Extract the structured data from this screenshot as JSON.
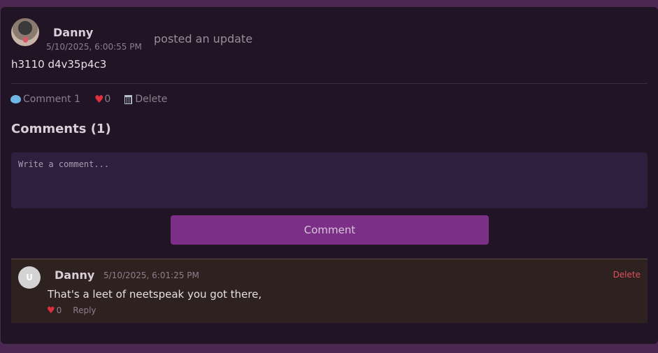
{
  "post": {
    "author": "Danny",
    "timestamp": "5/10/2025, 6:00:55 PM",
    "action_text": "posted an update",
    "body": "h3110 d4v35p4c3",
    "actions": {
      "comment_label": "Comment 1",
      "like_count": "0",
      "delete_label": "Delete"
    }
  },
  "comments_section": {
    "title": "Comments (1)",
    "input_placeholder": "Write a comment...",
    "submit_label": "Comment",
    "items": [
      {
        "avatar_initial": "U",
        "author": "Danny",
        "timestamp": "5/10/2025, 6:01:25 PM",
        "delete_label": "Delete",
        "text": "That's a leet of neetspeak you got there,",
        "like_count": "0",
        "reply_label": "Reply"
      }
    ]
  },
  "icons": {
    "comment": "speech-bubble-icon",
    "like": "heart-icon",
    "delete": "wastebasket-icon"
  },
  "colors": {
    "background": "#4a2850",
    "card": "#211424",
    "accent_button": "#7b2f86",
    "heart": "#e0303f",
    "delete_link": "#e0505a",
    "comment_card": "#2d2220"
  }
}
